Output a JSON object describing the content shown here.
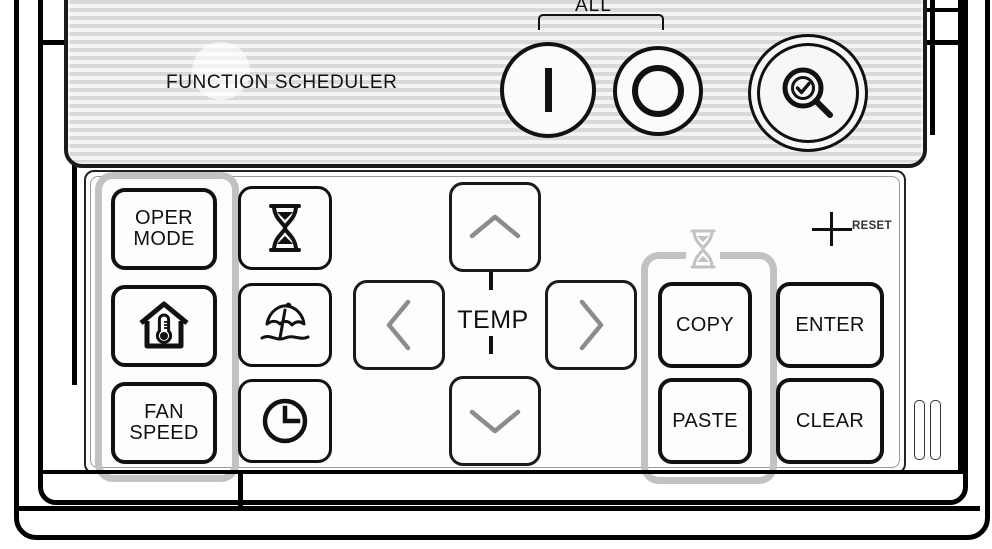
{
  "device": {
    "name": "air-conditioner-function-scheduler-controller",
    "head_label": "FUNCTION SCHEDULER",
    "all_label": "ALL",
    "reset_label": "RESET"
  },
  "head_controls": [
    {
      "id": "power-on",
      "icon": "power-on-bar-icon",
      "label": ""
    },
    {
      "id": "power-off",
      "icon": "power-off-ring-icon",
      "label": ""
    },
    {
      "id": "check",
      "icon": "magnifier-check-icon",
      "label": ""
    }
  ],
  "keypad": {
    "left_column": [
      {
        "id": "oper-mode",
        "label": "OPER\nMODE",
        "line1": "OPER",
        "line2": "MODE",
        "icon": ""
      },
      {
        "id": "room-temp",
        "label": "",
        "icon": "house-thermometer-icon"
      },
      {
        "id": "fan-speed",
        "label": "FAN\nSPEED",
        "line1": "FAN",
        "line2": "SPEED",
        "icon": ""
      }
    ],
    "second_column": [
      {
        "id": "timer",
        "label": "",
        "icon": "hourglass-icon"
      },
      {
        "id": "holiday",
        "label": "",
        "icon": "beach-umbrella-icon"
      },
      {
        "id": "schedule",
        "label": "",
        "icon": "clock-icon"
      }
    ],
    "temp_cluster": {
      "label": "TEMP",
      "up": {
        "id": "temp-up",
        "icon": "chevron-up-icon"
      },
      "down": {
        "id": "temp-down",
        "icon": "chevron-down-icon"
      },
      "left": {
        "id": "nav-left",
        "icon": "chevron-left-icon"
      },
      "right": {
        "id": "nav-right",
        "icon": "chevron-right-icon"
      }
    },
    "edit_group": {
      "icon": "hourglass-small-icon",
      "buttons": [
        {
          "id": "copy",
          "label": "COPY"
        },
        {
          "id": "paste",
          "label": "PASTE"
        }
      ]
    },
    "action_buttons": [
      {
        "id": "enter",
        "label": "ENTER"
      },
      {
        "id": "clear",
        "label": "CLEAR"
      }
    ]
  },
  "colors": {
    "outline": "#111111",
    "group_bracket": "#c2c2c2",
    "stripe_dark": "#d9d9d9",
    "stripe_light": "#f4f4f4",
    "body": "#fdfdfd"
  }
}
